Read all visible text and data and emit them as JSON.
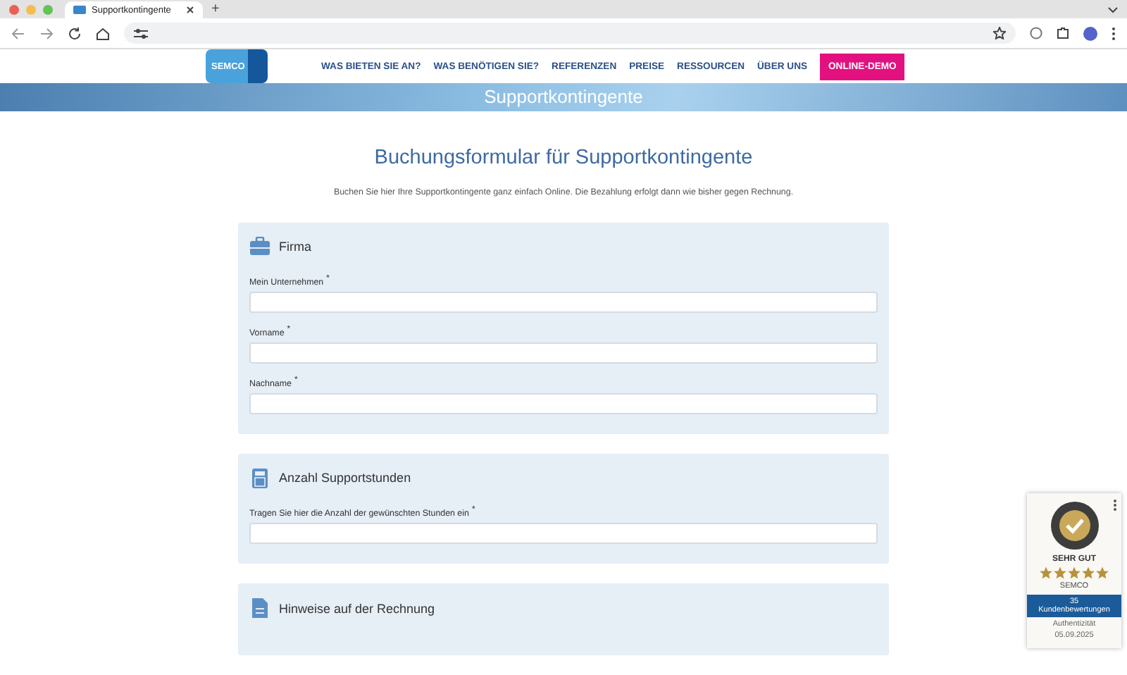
{
  "browser": {
    "tabs": [
      {
        "title": "Supportkontingente",
        "selected": true
      }
    ],
    "new_tab": "+"
  },
  "nav": {
    "logo": "SEMCO",
    "items": [
      {
        "label": "WAS BIETEN SIE AN?",
        "kind": "link"
      },
      {
        "label": "WAS BENÖTIGEN SIE?",
        "kind": "link"
      },
      {
        "label": "REFERENZEN",
        "kind": "link"
      },
      {
        "label": "PREISE",
        "kind": "link"
      },
      {
        "label": "RESSOURCEN",
        "kind": "link"
      },
      {
        "label": "ÜBER UNS",
        "kind": "link"
      },
      {
        "label": "ONLINE-DEMO",
        "kind": "cta"
      }
    ]
  },
  "hero": {
    "title": "Supportkontingente"
  },
  "form": {
    "title": "Buchungsformular für Supportkontingente",
    "intro": "Buchen Sie hier Ihre Supportkontingente ganz einfach Online. Die Bezahlung erfolgt dann wie bisher gegen Rechnung.",
    "sections": [
      {
        "title": "Firma",
        "fields": [
          {
            "label": "Mein Unternehmen",
            "required_mark": "*"
          },
          {
            "label": "Vorname",
            "required_mark": "*"
          },
          {
            "label": "Nachname",
            "required_mark": "*"
          }
        ]
      },
      {
        "title": "Anzahl Supportstunden",
        "fields": [
          {
            "label": "Tragen Sie hier die Anzahl der gewünschten Stunden ein",
            "required_mark": "*"
          }
        ]
      },
      {
        "title": "Hinweise auf der Rechnung"
      }
    ]
  },
  "rating_badge": {
    "verdict": "SEHR GUT",
    "stars": 5,
    "company": "SEMCO",
    "count": "35",
    "count_label": "Kundenbewertungen",
    "note": "Authentizität",
    "date": "05.09.2025"
  }
}
